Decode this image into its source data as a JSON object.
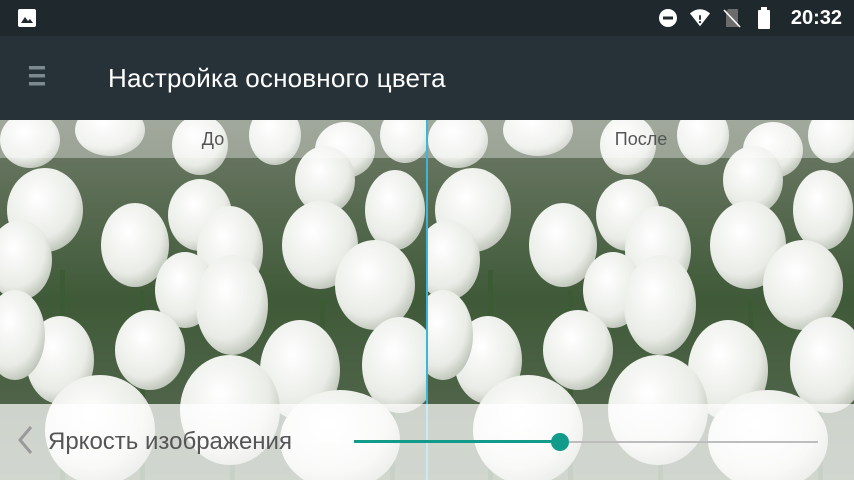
{
  "status_bar": {
    "time": "20:32",
    "icons": [
      "image-icon",
      "do-not-disturb-icon",
      "wifi-icon",
      "no-sim-icon",
      "battery-icon"
    ]
  },
  "app_bar": {
    "title": "Настройка основного цвета",
    "menu_icon": "menu-icon"
  },
  "preview": {
    "before_label": "До",
    "after_label": "После",
    "divider_color": "#3bb6d6"
  },
  "control": {
    "label": "Яркость изображения",
    "back_icon": "chevron-left-icon",
    "slider_value": 0.445,
    "accent_color": "#129b8a"
  }
}
